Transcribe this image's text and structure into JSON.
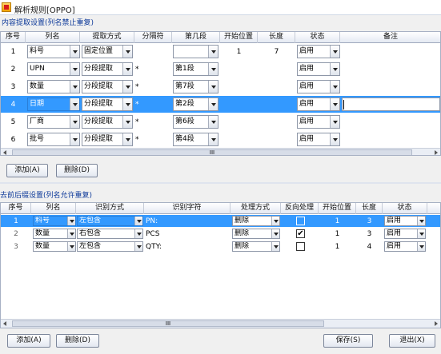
{
  "window": {
    "title": "解析规则[OPPO]"
  },
  "section1": {
    "title": "内容提取设置(列名禁止重复)",
    "columns": [
      "序号",
      "列名",
      "提取方式",
      "分隔符",
      "第几段",
      "开始位置",
      "长度",
      "状态",
      "备注"
    ],
    "rows": [
      {
        "no": "1",
        "name": "料号",
        "method": "固定位置",
        "sep": "",
        "seg": "",
        "start": "1",
        "len": "7",
        "status": "启用",
        "note": ""
      },
      {
        "no": "2",
        "name": "UPN",
        "method": "分段提取",
        "sep": "*",
        "seg": "第1段",
        "start": "",
        "len": "",
        "status": "启用",
        "note": ""
      },
      {
        "no": "3",
        "name": "数量",
        "method": "分段提取",
        "sep": "*",
        "seg": "第7段",
        "start": "",
        "len": "",
        "status": "启用",
        "note": ""
      },
      {
        "no": "4",
        "name": "日期",
        "method": "分段提取",
        "sep": "*",
        "seg": "第2段",
        "start": "",
        "len": "",
        "status": "启用",
        "note": ""
      },
      {
        "no": "5",
        "name": "厂商",
        "method": "分段提取",
        "sep": "*",
        "seg": "第6段",
        "start": "",
        "len": "",
        "status": "启用",
        "note": ""
      },
      {
        "no": "6",
        "name": "批号",
        "method": "分段提取",
        "sep": "*",
        "seg": "第4段",
        "start": "",
        "len": "",
        "status": "启用",
        "note": ""
      }
    ],
    "scroll_label": "III",
    "add_label": "添加(A)",
    "delete_label": "删除(D)"
  },
  "section2": {
    "title": "去前后缀设置(列名允许重复)",
    "columns": [
      "序号",
      "列名",
      "识别方式",
      "识别字符",
      "处理方式",
      "反向处理",
      "开始位置",
      "长度",
      "状态"
    ],
    "rows": [
      {
        "no": "1",
        "name": "料号",
        "method": "左包含",
        "chars": "PN:",
        "handle": "删除",
        "reverse": false,
        "start": "1",
        "len": "3",
        "status": "启用"
      },
      {
        "no": "2",
        "name": "数量",
        "method": "右包含",
        "chars": "PCS",
        "handle": "删除",
        "reverse": true,
        "start": "1",
        "len": "3",
        "status": "启用"
      },
      {
        "no": "3",
        "name": "数量",
        "method": "左包含",
        "chars": "QTY:",
        "handle": "删除",
        "reverse": false,
        "start": "1",
        "len": "4",
        "status": "启用"
      }
    ],
    "scroll_label": "III",
    "add_label": "添加(A)",
    "delete_label": "删除(D)",
    "save_label": "保存(S)",
    "exit_label": "退出(X)"
  },
  "colors": {
    "selection": "#3399ff",
    "section_title": "#0e3a9a"
  }
}
